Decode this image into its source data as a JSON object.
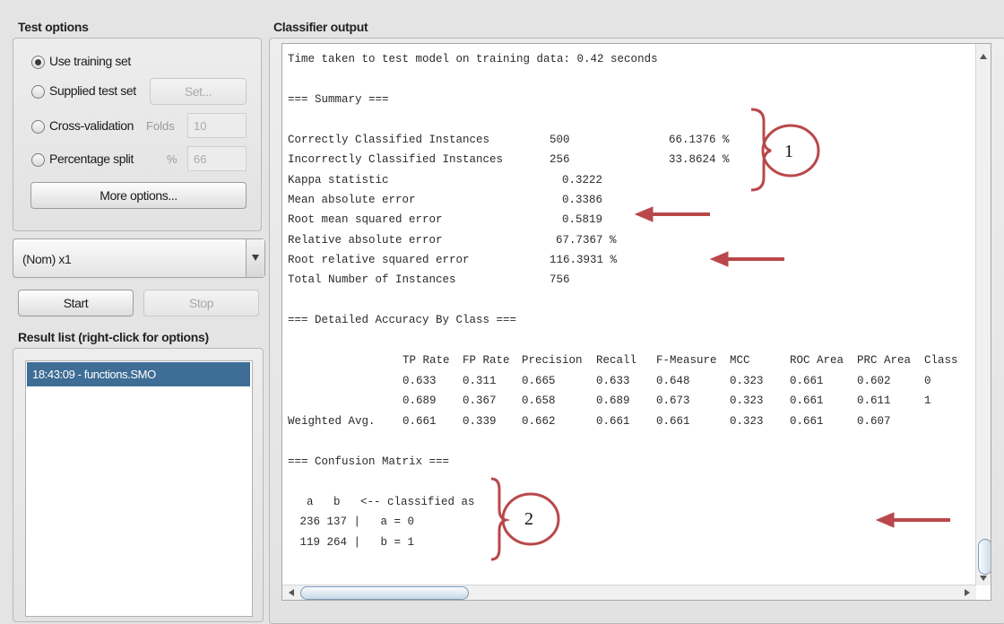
{
  "test_options": {
    "title": "Test options",
    "use_training_set": "Use training set",
    "supplied_test_set": "Supplied test set",
    "set_button": "Set...",
    "cross_validation": "Cross-validation",
    "folds_label": "Folds",
    "folds_value": "10",
    "percentage_split": "Percentage split",
    "percent_label": "%",
    "percent_value": "66",
    "more_options": "More options...",
    "selected": "use_training_set"
  },
  "class_select": {
    "value": "(Nom) x1"
  },
  "controls": {
    "start": "Start",
    "stop": "Stop"
  },
  "result_list": {
    "title": "Result list (right-click for options)",
    "items": [
      "18:43:09 - functions.SMO"
    ]
  },
  "classifier_output": {
    "title": "Classifier output",
    "time_line": "Time taken to test model on training data: 0.42 seconds",
    "summary_header": "=== Summary ===",
    "summary": [
      {
        "label": "Correctly Classified Instances",
        "value": "500",
        "pct": "66.1376 %"
      },
      {
        "label": "Incorrectly Classified Instances",
        "value": "256",
        "pct": "33.8624 %"
      },
      {
        "label": "Kappa statistic",
        "value": "0.3222",
        "pct": ""
      },
      {
        "label": "Mean absolute error",
        "value": "0.3386",
        "pct": ""
      },
      {
        "label": "Root mean squared error",
        "value": "0.5819",
        "pct": ""
      },
      {
        "label": "Relative absolute error",
        "value": "67.7367 %",
        "pct": ""
      },
      {
        "label": "Root relative squared error",
        "value": "116.3931 %",
        "pct": ""
      },
      {
        "label": "Total Number of Instances",
        "value": "756",
        "pct": ""
      }
    ],
    "accuracy_header": "=== Detailed Accuracy By Class ===",
    "accuracy_columns": [
      "TP Rate",
      "FP Rate",
      "Precision",
      "Recall",
      "F-Measure",
      "MCC",
      "ROC Area",
      "PRC Area",
      "Class"
    ],
    "accuracy_rows": [
      {
        "label": "",
        "cells": [
          "0.633",
          "0.311",
          "0.665",
          "0.633",
          "0.648",
          "0.323",
          "0.661",
          "0.602",
          "0"
        ]
      },
      {
        "label": "",
        "cells": [
          "0.689",
          "0.367",
          "0.658",
          "0.689",
          "0.673",
          "0.323",
          "0.661",
          "0.611",
          "1"
        ]
      },
      {
        "label": "Weighted Avg.",
        "cells": [
          "0.661",
          "0.339",
          "0.662",
          "0.661",
          "0.661",
          "0.323",
          "0.661",
          "0.607",
          ""
        ]
      }
    ],
    "confusion_header": "=== Confusion Matrix ===",
    "confusion_lines": [
      "  a   b   <-- classified as",
      " 236 137 |   a = 0",
      " 119 264 |   b = 1"
    ]
  },
  "annotations": {
    "label_1": "1",
    "label_2": "2",
    "color": "#b9484a"
  }
}
